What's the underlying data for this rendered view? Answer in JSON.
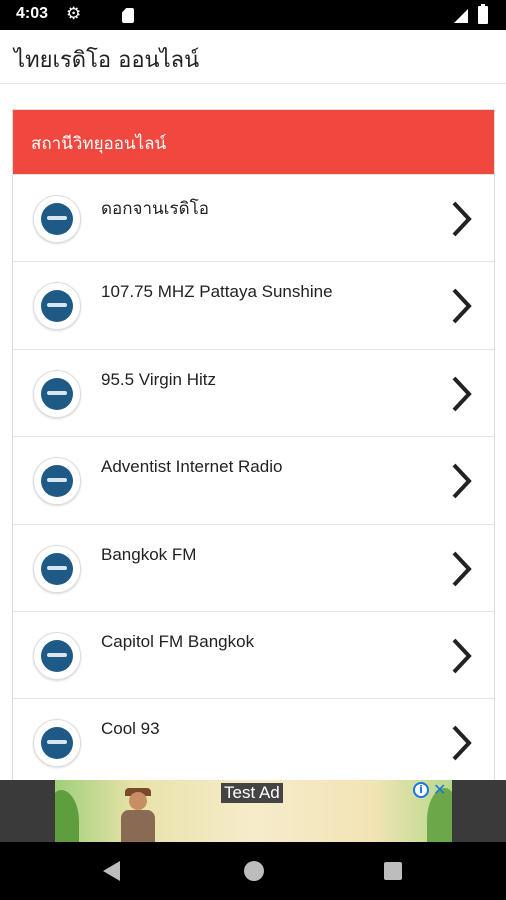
{
  "status": {
    "time": "4:03",
    "icons": [
      "gear-icon",
      "sd-card-icon",
      "signal-icon",
      "battery-icon"
    ]
  },
  "app": {
    "title": "ไทยเรดิโอ ออนไลน์"
  },
  "section": {
    "header": "สถานีวิทยุออนไลน์",
    "accent_color": "#f0483e"
  },
  "stations": [
    {
      "name": "ดอกจานเรดิโอ"
    },
    {
      "name": "107.75 MHZ Pattaya Sunshine"
    },
    {
      "name": "95.5 Virgin Hitz"
    },
    {
      "name": "Adventist Internet Radio"
    },
    {
      "name": "Bangkok FM"
    },
    {
      "name": "Capitol FM Bangkok"
    },
    {
      "name": "Cool 93"
    }
  ],
  "ad": {
    "label": "Test Ad",
    "info_icon": "info-icon",
    "close_icon": "close-icon"
  },
  "nav": {
    "icons": [
      "back-icon",
      "home-icon",
      "recent-apps-icon"
    ]
  }
}
